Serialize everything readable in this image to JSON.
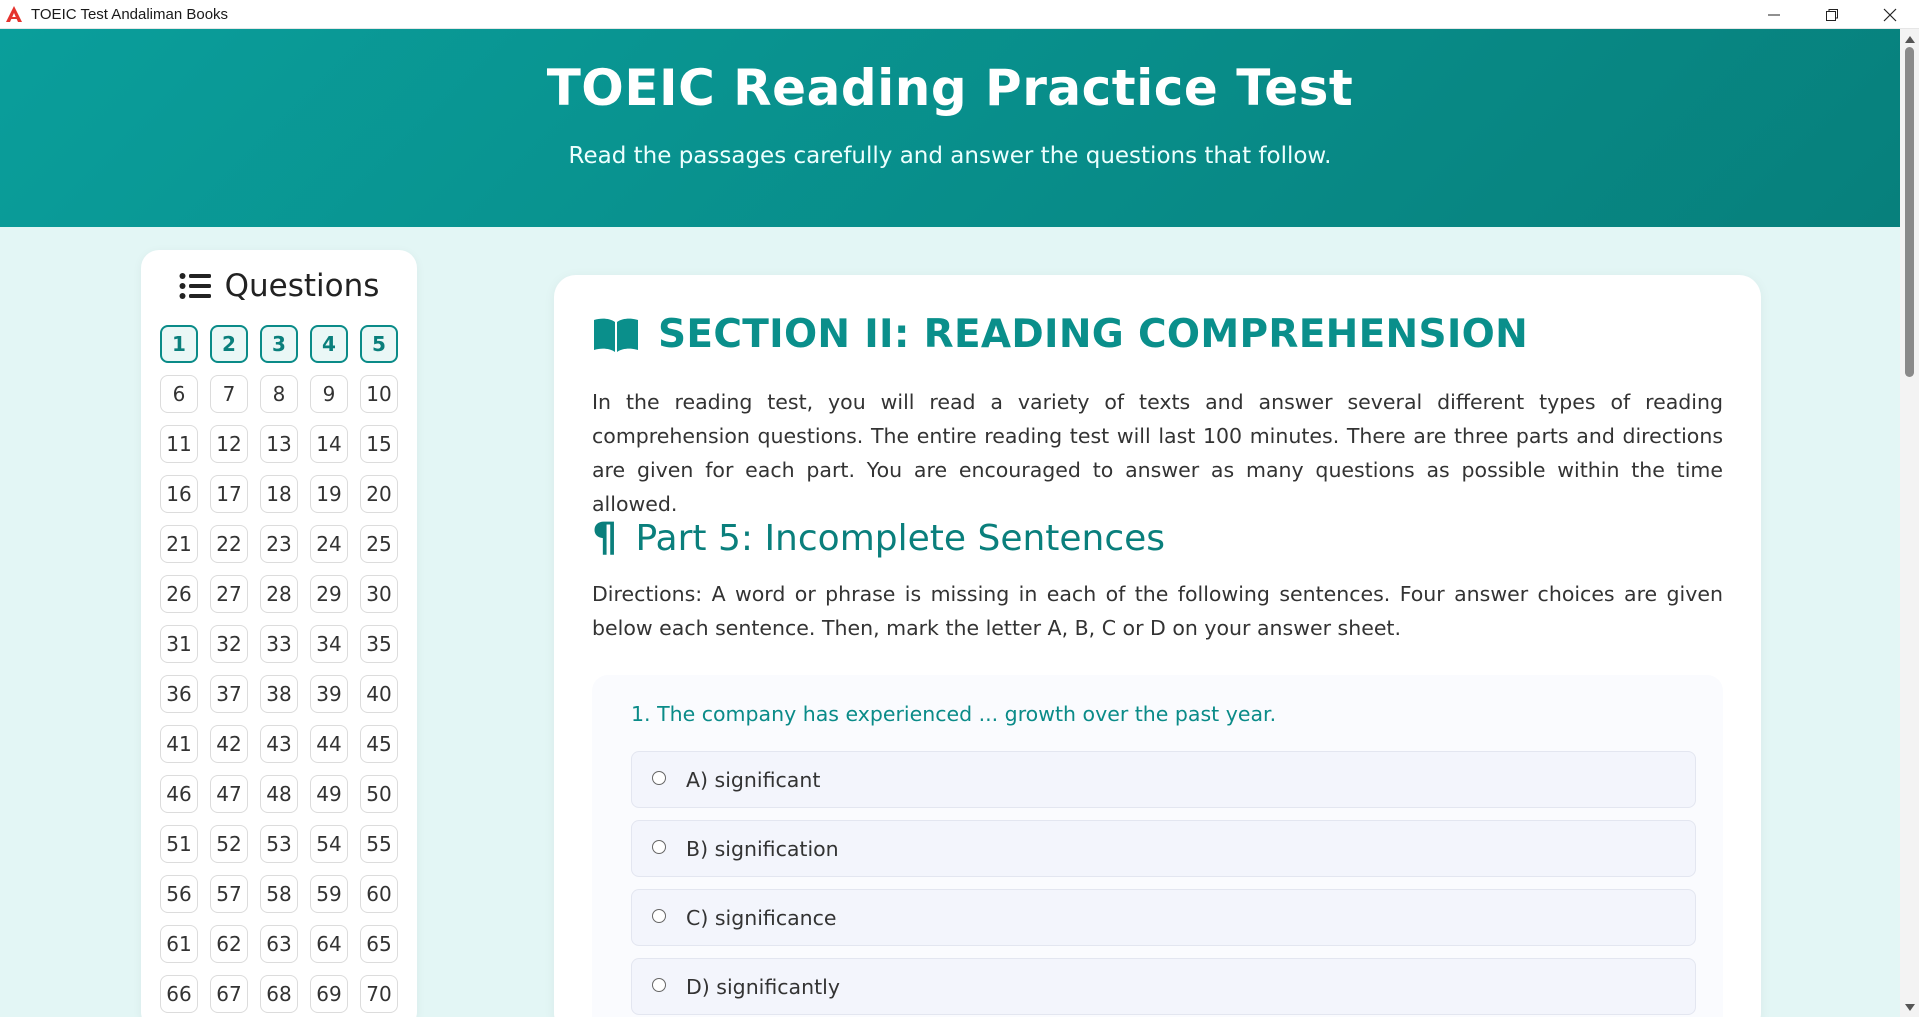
{
  "window": {
    "title": "TOEIC Test Andaliman Books"
  },
  "header": {
    "title": "TOEIC Reading Practice Test",
    "subtitle": "Read the passages carefully and answer the questions that follow."
  },
  "sidebar": {
    "title": "Questions",
    "answered": [
      1,
      2,
      3,
      4,
      5
    ],
    "numbers": [
      "1",
      "2",
      "3",
      "4",
      "5",
      "6",
      "7",
      "8",
      "9",
      "10",
      "11",
      "12",
      "13",
      "14",
      "15",
      "16",
      "17",
      "18",
      "19",
      "20",
      "21",
      "22",
      "23",
      "24",
      "25",
      "26",
      "27",
      "28",
      "29",
      "30",
      "31",
      "32",
      "33",
      "34",
      "35",
      "36",
      "37",
      "38",
      "39",
      "40",
      "41",
      "42",
      "43",
      "44",
      "45",
      "46",
      "47",
      "48",
      "49",
      "50",
      "51",
      "52",
      "53",
      "54",
      "55",
      "56",
      "57",
      "58",
      "59",
      "60",
      "61",
      "62",
      "63",
      "64",
      "65",
      "66",
      "67",
      "68",
      "69",
      "70"
    ]
  },
  "main": {
    "section_title": "SECTION II: READING COMPREHENSION",
    "intro": "In the reading test, you will read a variety of texts and answer several different types of reading comprehension questions. The entire reading test will last 100 minutes. There are three parts and directions are given for each part. You are encouraged to answer as many questions as possible within the time allowed.",
    "part_symbol": "¶",
    "part_title": "Part 5: Incomplete Sentences",
    "directions": "Directions: A word or phrase is missing in each of the following sentences. Four answer choices are given below each sentence. Then, mark the letter A, B, C or D on your answer sheet.",
    "question": {
      "text": "1. The company has experienced ... growth over the past year.",
      "options": [
        "A) significant",
        "B) signification",
        "C) significance",
        "D) significantly"
      ]
    }
  },
  "colors": {
    "accent": "#0a8f8b",
    "header_start": "#0a9e9b",
    "header_end": "#07807c",
    "background": "#e3f6f5"
  }
}
